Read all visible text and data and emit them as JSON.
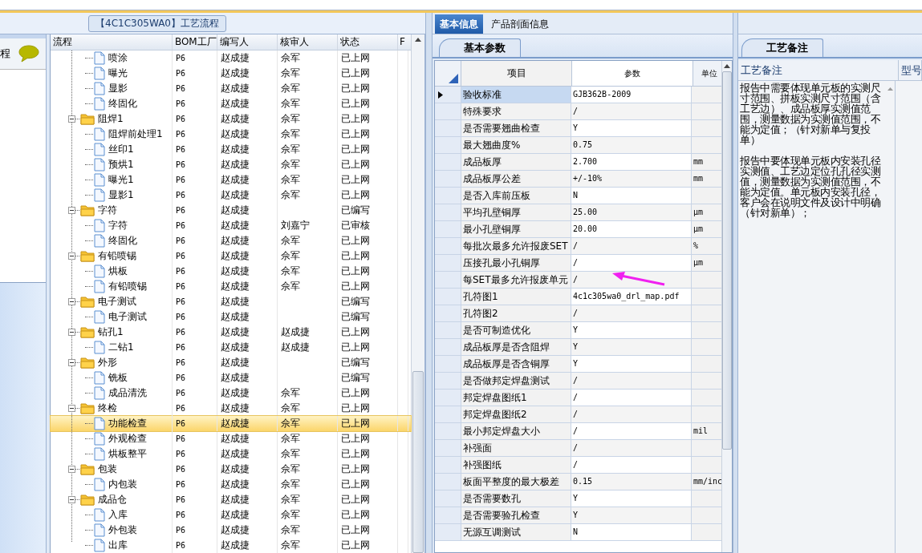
{
  "process_pane": {
    "caption": "【4C1C305WA0】工艺流程",
    "side_label": "程",
    "tree": {
      "columns": [
        "流程",
        "BOM工厂",
        "编写人",
        "核审人",
        "状态",
        "F"
      ],
      "rows": [
        {
          "kind": "file",
          "label": "喷涂",
          "factory": "P6",
          "author": "赵成捷",
          "reviewer": "佘军",
          "status": "已上网",
          "selected": false
        },
        {
          "kind": "file",
          "label": "曝光",
          "factory": "P6",
          "author": "赵成捷",
          "reviewer": "佘军",
          "status": "已上网",
          "selected": false
        },
        {
          "kind": "file",
          "label": "显影",
          "factory": "P6",
          "author": "赵成捷",
          "reviewer": "佘军",
          "status": "已上网",
          "selected": false
        },
        {
          "kind": "file",
          "label": "终固化",
          "factory": "P6",
          "author": "赵成捷",
          "reviewer": "佘军",
          "status": "已上网",
          "selected": false
        },
        {
          "kind": "folder",
          "label": "阻焊1",
          "factory": "P6",
          "author": "赵成捷",
          "reviewer": "佘军",
          "status": "已上网",
          "selected": false,
          "expanded": true,
          "children": [
            {
              "kind": "file",
              "label": "阻焊前处理1",
              "factory": "P6",
              "author": "赵成捷",
              "reviewer": "佘军",
              "status": "已上网",
              "selected": false
            },
            {
              "kind": "file",
              "label": "丝印1",
              "factory": "P6",
              "author": "赵成捷",
              "reviewer": "佘军",
              "status": "已上网",
              "selected": false
            },
            {
              "kind": "file",
              "label": "预烘1",
              "factory": "P6",
              "author": "赵成捷",
              "reviewer": "佘军",
              "status": "已上网",
              "selected": false
            },
            {
              "kind": "file",
              "label": "曝光1",
              "factory": "P6",
              "author": "赵成捷",
              "reviewer": "佘军",
              "status": "已上网",
              "selected": false
            },
            {
              "kind": "file",
              "label": "显影1",
              "factory": "P6",
              "author": "赵成捷",
              "reviewer": "佘军",
              "status": "已上网",
              "selected": false
            }
          ]
        },
        {
          "kind": "folder",
          "label": "字符",
          "factory": "P6",
          "author": "赵成捷",
          "status": "已编写",
          "selected": false,
          "expanded": true,
          "children": [
            {
              "kind": "file",
              "label": "字符",
              "factory": "P6",
              "author": "赵成捷",
              "reviewer": "刘嘉宁",
              "status": "已审核",
              "selected": false
            },
            {
              "kind": "file",
              "label": "终固化",
              "factory": "P6",
              "author": "赵成捷",
              "reviewer": "佘军",
              "status": "已上网",
              "selected": false
            }
          ]
        },
        {
          "kind": "folder",
          "label": "有铅喷锡",
          "factory": "P6",
          "author": "赵成捷",
          "reviewer": "佘军",
          "status": "已上网",
          "selected": false,
          "expanded": true,
          "children": [
            {
              "kind": "file",
              "label": "烘板",
              "factory": "P6",
              "author": "赵成捷",
              "reviewer": "佘军",
              "status": "已上网",
              "selected": false
            },
            {
              "kind": "file",
              "label": "有铅喷锡",
              "factory": "P6",
              "author": "赵成捷",
              "reviewer": "佘军",
              "status": "已上网",
              "selected": false
            }
          ]
        },
        {
          "kind": "folder",
          "label": "电子测试",
          "factory": "P6",
          "author": "赵成捷",
          "status": "已编写",
          "selected": false,
          "expanded": true,
          "children": [
            {
              "kind": "file",
              "label": "电子测试",
              "factory": "P6",
              "author": "赵成捷",
              "status": "已编写",
              "selected": false
            }
          ]
        },
        {
          "kind": "folder",
          "label": "钻孔1",
          "factory": "P6",
          "author": "赵成捷",
          "reviewer": "赵成捷",
          "status": "已上网",
          "selected": false,
          "expanded": true,
          "children": [
            {
              "kind": "file",
              "label": "二钻1",
              "factory": "P6",
              "author": "赵成捷",
              "reviewer": "赵成捷",
              "status": "已上网",
              "selected": false
            }
          ]
        },
        {
          "kind": "folder",
          "label": "外形",
          "factory": "P6",
          "author": "赵成捷",
          "status": "已编写",
          "selected": false,
          "expanded": true,
          "children": [
            {
              "kind": "file",
              "label": "铣板",
              "factory": "P6",
              "author": "赵成捷",
              "status": "已编写",
              "selected": false
            },
            {
              "kind": "file",
              "label": "成品清洗",
              "factory": "P6",
              "author": "赵成捷",
              "reviewer": "佘军",
              "status": "已上网",
              "selected": false
            }
          ]
        },
        {
          "kind": "folder",
          "label": "终检",
          "factory": "P6",
          "author": "赵成捷",
          "reviewer": "佘军",
          "status": "已上网",
          "selected": false,
          "expanded": true,
          "children": [
            {
              "kind": "file",
              "label": "功能检查",
              "factory": "P6",
              "author": "赵成捷",
              "reviewer": "佘军",
              "status": "已上网",
              "selected": true
            },
            {
              "kind": "file",
              "label": "外观检查",
              "factory": "P6",
              "author": "赵成捷",
              "reviewer": "佘军",
              "status": "已上网",
              "selected": false
            },
            {
              "kind": "file",
              "label": "烘板整平",
              "factory": "P6",
              "author": "赵成捷",
              "reviewer": "佘军",
              "status": "已上网",
              "selected": false
            }
          ]
        },
        {
          "kind": "folder",
          "label": "包装",
          "factory": "P6",
          "author": "赵成捷",
          "reviewer": "佘军",
          "status": "已上网",
          "selected": false,
          "expanded": true,
          "children": [
            {
              "kind": "file",
              "label": "内包装",
              "factory": "P6",
              "author": "赵成捷",
              "reviewer": "佘军",
              "status": "已上网",
              "selected": false
            }
          ]
        },
        {
          "kind": "folder",
          "label": "成品仓",
          "factory": "P6",
          "author": "赵成捷",
          "reviewer": "佘军",
          "status": "已上网",
          "selected": false,
          "expanded": true,
          "children": [
            {
              "kind": "file",
              "label": "入库",
              "factory": "P6",
              "author": "赵成捷",
              "reviewer": "佘军",
              "status": "已上网",
              "selected": false
            },
            {
              "kind": "file",
              "label": "外包装",
              "factory": "P6",
              "author": "赵成捷",
              "reviewer": "佘军",
              "status": "已上网",
              "selected": false
            },
            {
              "kind": "file",
              "label": "出库",
              "factory": "P6",
              "author": "赵成捷",
              "reviewer": "佘军",
              "status": "已上网",
              "selected": false
            }
          ]
        }
      ]
    }
  },
  "info_pane": {
    "tabs": [
      {
        "label": "基本信息",
        "selected": true
      },
      {
        "label": "产品剖面信息",
        "selected": false
      }
    ],
    "sub_tab": "基本参数",
    "grid": {
      "columns": [
        "项目",
        "参数",
        "单位"
      ],
      "rows": [
        {
          "item": "验收标准",
          "value": "GJB362B-2009",
          "selected": true
        },
        {
          "item": "特殊要求",
          "value": "/",
          "selected": false
        },
        {
          "item": "是否需要翘曲检查",
          "value": "Y",
          "selected": false
        },
        {
          "item": "最大翘曲度%",
          "value": "0.75",
          "selected": false
        },
        {
          "item": "成品板厚",
          "value": "2.700",
          "unit": "mm",
          "selected": false
        },
        {
          "item": "成品板厚公差",
          "value": "+/-10%",
          "unit": "mm",
          "selected": false
        },
        {
          "item": "是否入库前压板",
          "value": "N",
          "selected": false
        },
        {
          "item": "平均孔壁铜厚",
          "value": "25.00",
          "unit": "μm",
          "selected": false
        },
        {
          "item": "最小孔壁铜厚",
          "value": "20.00",
          "unit": "μm",
          "selected": false
        },
        {
          "item": "每批次最多允许报废SET",
          "value": "/",
          "unit": "%",
          "selected": false
        },
        {
          "item": "压接孔最小孔铜厚",
          "value": "/",
          "unit": "μm",
          "selected": false
        },
        {
          "item": "每SET最多允许报废单元",
          "value": "/",
          "selected": false
        },
        {
          "item": "孔符图1",
          "value": "4c1c305wa0_drl_map.pdf",
          "selected": false
        },
        {
          "item": "孔符图2",
          "value": "/",
          "selected": false
        },
        {
          "item": "是否可制造优化",
          "value": "Y",
          "selected": false
        },
        {
          "item": "成品板厚是否含阻焊",
          "value": "Y",
          "selected": false
        },
        {
          "item": "成品板厚是否含铜厚",
          "value": "Y",
          "selected": false
        },
        {
          "item": "是否做邦定焊盘测试",
          "value": "/",
          "selected": false
        },
        {
          "item": "邦定焊盘图纸1",
          "value": "/",
          "selected": false
        },
        {
          "item": "邦定焊盘图纸2",
          "value": "/",
          "selected": false
        },
        {
          "item": "最小邦定焊盘大小",
          "value": "/",
          "unit": "mil",
          "selected": false
        },
        {
          "item": "补强面",
          "value": "/",
          "selected": false
        },
        {
          "item": "补强图纸",
          "value": "/",
          "selected": false
        },
        {
          "item": "板面平整度的最大极差",
          "value": "0.15",
          "unit": "mm/inc",
          "selected": false
        },
        {
          "item": "是否需要数孔",
          "value": "Y",
          "selected": false
        },
        {
          "item": "是否需要验孔检查",
          "value": "Y",
          "selected": false
        },
        {
          "item": "无源互调测试",
          "value": "N",
          "selected": false
        }
      ]
    }
  },
  "notes_pane": {
    "tab": "工艺备注",
    "columns": [
      "工艺备注",
      "型号"
    ],
    "notes": [
      "报告中需要体现单元板的实测尺寸范围、拼板实测尺寸范围（含工艺边）、成品板厚实测值范围，测量数据为实测值范围，不能为定值；（针对新单与复投单）",
      "报告中要体现单元板内安装孔径实测值、工艺边定位孔孔径实测值，测量数据为实测值范围，不能为定值。单元板内安装孔径，客户会在说明文件及设计中明确（针对新单）；"
    ]
  }
}
